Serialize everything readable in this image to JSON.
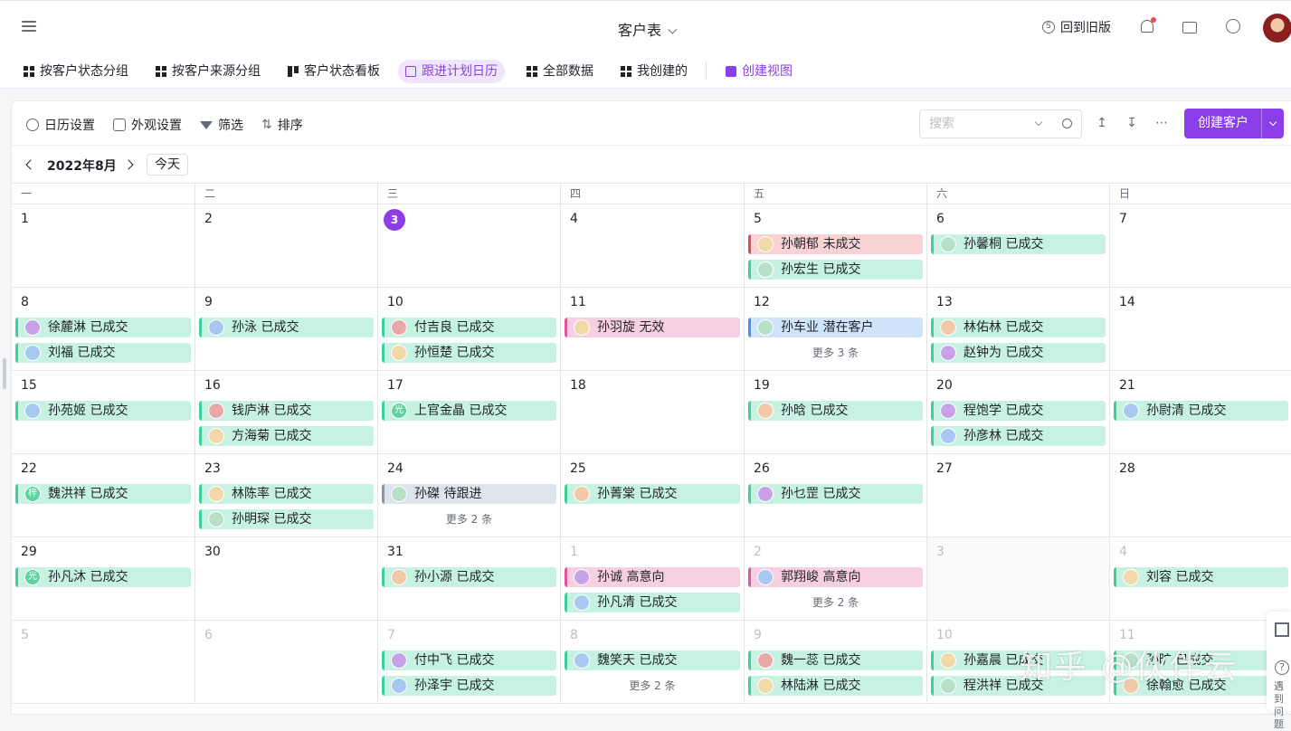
{
  "header": {
    "title": "客户表",
    "back_old": "回到旧版",
    "back_old_icon_glyph": "S"
  },
  "tabs": [
    {
      "label": "按客户状态分组",
      "icon": "grid-icon"
    },
    {
      "label": "按客户来源分组",
      "icon": "grid-icon"
    },
    {
      "label": "客户状态看板",
      "icon": "kanban-icon"
    },
    {
      "label": "跟进计划日历",
      "icon": "calendar-icon",
      "active": true
    },
    {
      "label": "全部数据",
      "icon": "grid-icon"
    },
    {
      "label": "我创建的",
      "icon": "grid-icon"
    },
    {
      "label": "创建视图",
      "icon": "plus-icon"
    }
  ],
  "toolbar": {
    "calendar_settings": "日历设置",
    "appearance": "外观设置",
    "filter": "筛选",
    "sort": "排序",
    "search_placeholder": "搜索",
    "create_customer": "创建客户",
    "icon_upload": "↥",
    "icon_download": "↧",
    "icon_more": "⋯",
    "icon_sort": "⇅"
  },
  "calendar": {
    "month": "2022年8月",
    "today_label": "今天",
    "weekdays": [
      "一",
      "二",
      "三",
      "四",
      "五",
      "六",
      "日"
    ],
    "weeks": [
      [
        {
          "day": "1",
          "events": []
        },
        {
          "day": "2",
          "events": []
        },
        {
          "day": "3",
          "today": true,
          "events": []
        },
        {
          "day": "4",
          "events": []
        },
        {
          "day": "5",
          "events": [
            {
              "text": "孙朝郁 未成交",
              "color": "red"
            },
            {
              "text": "孙宏生 已成交",
              "color": "green"
            }
          ]
        },
        {
          "day": "6",
          "weekend": true,
          "events": [
            {
              "text": "孙馨桐 已成交",
              "color": "green"
            }
          ]
        },
        {
          "day": "7",
          "weekend": true,
          "events": []
        }
      ],
      [
        {
          "day": "8",
          "events": [
            {
              "text": "徐麓淋 已成交",
              "color": "green"
            },
            {
              "text": "刘福 已成交",
              "color": "green"
            }
          ]
        },
        {
          "day": "9",
          "events": [
            {
              "text": "孙泳 已成交",
              "color": "green"
            }
          ]
        },
        {
          "day": "10",
          "events": [
            {
              "text": "付吉良 已成交",
              "color": "green"
            },
            {
              "text": "孙恒楚 已成交",
              "color": "green"
            }
          ]
        },
        {
          "day": "11",
          "events": [
            {
              "text": "孙羽旋 无效",
              "color": "pink"
            }
          ]
        },
        {
          "day": "12",
          "events": [
            {
              "text": "孙车业 潜在客户",
              "color": "blue"
            }
          ],
          "more": "更多 3 条"
        },
        {
          "day": "13",
          "weekend": true,
          "events": [
            {
              "text": "林佑林 已成交",
              "color": "green"
            },
            {
              "text": "赵钟为 已成交",
              "color": "green"
            }
          ]
        },
        {
          "day": "14",
          "weekend": true,
          "events": []
        }
      ],
      [
        {
          "day": "15",
          "events": [
            {
              "text": "孙苑姬 已成交",
              "color": "green"
            }
          ]
        },
        {
          "day": "16",
          "events": [
            {
              "text": "钱庐淋 已成交",
              "color": "green"
            },
            {
              "text": "方海菊 已成交",
              "color": "green"
            }
          ]
        },
        {
          "day": "17",
          "events": [
            {
              "text": "上官金晶 已成交",
              "color": "green",
              "badge": "光"
            }
          ]
        },
        {
          "day": "18",
          "events": []
        },
        {
          "day": "19",
          "events": [
            {
              "text": "孙晗 已成交",
              "color": "green"
            }
          ]
        },
        {
          "day": "20",
          "weekend": true,
          "events": [
            {
              "text": "程饱学 已成交",
              "color": "green"
            },
            {
              "text": "孙彦林 已成交",
              "color": "green"
            }
          ]
        },
        {
          "day": "21",
          "weekend": true,
          "events": [
            {
              "text": "孙尉清 已成交",
              "color": "green"
            }
          ]
        }
      ],
      [
        {
          "day": "22",
          "events": [
            {
              "text": "魏洪祥 已成交",
              "color": "green",
              "badge": "梓"
            }
          ]
        },
        {
          "day": "23",
          "events": [
            {
              "text": "林陈率 已成交",
              "color": "green"
            },
            {
              "text": "孙明琛 已成交",
              "color": "green"
            }
          ]
        },
        {
          "day": "24",
          "events": [
            {
              "text": "孙磔 待跟进",
              "color": "gray"
            }
          ],
          "more": "更多 2 条"
        },
        {
          "day": "25",
          "events": [
            {
              "text": "孙菁棠 已成交",
              "color": "green"
            }
          ]
        },
        {
          "day": "26",
          "events": [
            {
              "text": "孙乜罡 已成交",
              "color": "green"
            }
          ]
        },
        {
          "day": "27",
          "weekend": true,
          "events": []
        },
        {
          "day": "28",
          "weekend": true,
          "events": []
        }
      ],
      [
        {
          "day": "29",
          "events": [
            {
              "text": "孙凡沐 已成交",
              "color": "green",
              "badge": "光"
            }
          ]
        },
        {
          "day": "30",
          "events": []
        },
        {
          "day": "31",
          "events": [
            {
              "text": "孙小源 已成交",
              "color": "green"
            }
          ]
        },
        {
          "day": "1",
          "other": true,
          "events": [
            {
              "text": "孙诚 高意向",
              "color": "pink"
            },
            {
              "text": "孙凡清 已成交",
              "color": "green"
            }
          ]
        },
        {
          "day": "2",
          "other": true,
          "events": [
            {
              "text": "郭翔峻 高意向",
              "color": "pink"
            }
          ],
          "more": "更多 2 条"
        },
        {
          "day": "3",
          "other": true,
          "weekend": true,
          "events": []
        },
        {
          "day": "4",
          "other": true,
          "weekend": true,
          "events": [
            {
              "text": "刘容 已成交",
              "color": "green"
            }
          ]
        }
      ],
      [
        {
          "day": "5",
          "other": true,
          "events": []
        },
        {
          "day": "6",
          "other": true,
          "events": []
        },
        {
          "day": "7",
          "other": true,
          "events": [
            {
              "text": "付中飞 已成交",
              "color": "green"
            },
            {
              "text": "孙泽宇 已成交",
              "color": "green"
            }
          ]
        },
        {
          "day": "8",
          "other": true,
          "events": [
            {
              "text": "魏笑天 已成交",
              "color": "green"
            }
          ],
          "more": "更多 2 条"
        },
        {
          "day": "9",
          "other": true,
          "events": [
            {
              "text": "魏一蕊 已成交",
              "color": "green"
            },
            {
              "text": "林陆淋 已成交",
              "color": "green"
            }
          ]
        },
        {
          "day": "10",
          "other": true,
          "weekend": true,
          "events": [
            {
              "text": "孙嘉晨 已成交",
              "color": "green"
            },
            {
              "text": "程洪祥 已成交",
              "color": "green"
            }
          ]
        },
        {
          "day": "11",
          "other": true,
          "weekend": true,
          "events": [
            {
              "text": "孙旷 已成交",
              "color": "green"
            },
            {
              "text": "徐翰愈 已成交",
              "color": "green"
            }
          ]
        }
      ]
    ]
  },
  "floating": {
    "help_text": "遇到问题",
    "help_glyph": "?"
  },
  "watermark": "知乎 @伙伴云"
}
